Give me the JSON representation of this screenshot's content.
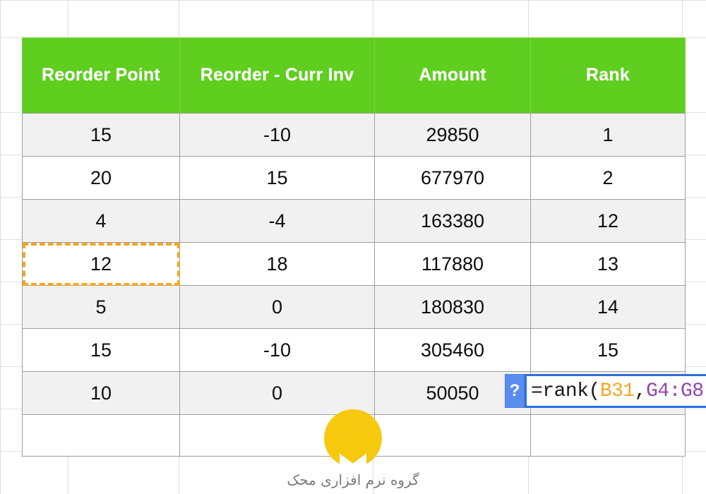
{
  "app": {
    "type": "spreadsheet",
    "accent_green": "#5FCE1F",
    "selection_orange": "#F5A623",
    "editor_blue": "#2a6fe0",
    "help_button_blue": "#5b8def"
  },
  "table": {
    "columns": [
      {
        "label": "Reorder Point",
        "key": "reorder_point"
      },
      {
        "label": "Reorder - Curr Inv",
        "key": "reorder_minus_curr_inv"
      },
      {
        "label": "Amount",
        "key": "amount"
      },
      {
        "label": "Rank",
        "key": "rank"
      }
    ],
    "rows": [
      {
        "reorder_point": "15",
        "reorder_minus_curr_inv": "-10",
        "amount": "29850",
        "rank": "1"
      },
      {
        "reorder_point": "20",
        "reorder_minus_curr_inv": "15",
        "amount": "677970",
        "rank": "2"
      },
      {
        "reorder_point": "4",
        "reorder_minus_curr_inv": "-4",
        "amount": "163380",
        "rank": "12"
      },
      {
        "reorder_point": "12",
        "reorder_minus_curr_inv": "18",
        "amount": "117880",
        "rank": "13"
      },
      {
        "reorder_point": "5",
        "reorder_minus_curr_inv": "0",
        "amount": "180830",
        "rank": "14"
      },
      {
        "reorder_point": "15",
        "reorder_minus_curr_inv": "-10",
        "amount": "305460",
        "rank": "15"
      },
      {
        "reorder_point": "10",
        "reorder_minus_curr_inv": "0",
        "amount": "50050",
        "rank": ""
      }
    ]
  },
  "selection": {
    "cell_value": "12",
    "column": "Reorder Point",
    "row_index": 4,
    "style": "dashed-marquee"
  },
  "formula_editor": {
    "help_label": "?",
    "help_icon_name": "question-mark-icon",
    "text": "=rank(B31,G4:G8",
    "tokens": [
      {
        "text": "=rank(",
        "kind": "plain"
      },
      {
        "text": "B31",
        "kind": "ref1"
      },
      {
        "text": ",",
        "kind": "plain"
      },
      {
        "text": "G4:G8",
        "kind": "ref2"
      }
    ]
  },
  "watermark": {
    "text": "گروه نرم افزاری محک",
    "logo_icon_name": "mahak-logo-icon",
    "logo_color": "#F6C90E"
  }
}
